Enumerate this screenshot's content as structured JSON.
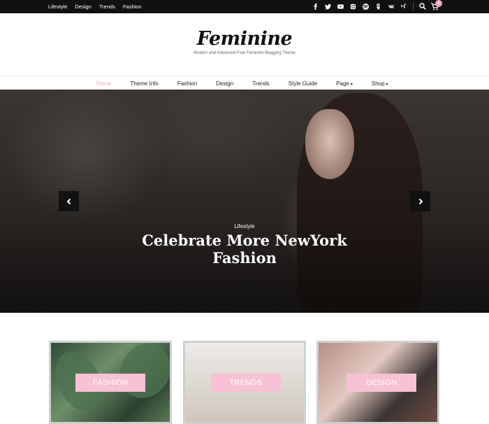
{
  "topbar": {
    "nav": [
      "Lifestyle",
      "Design",
      "Trends",
      "Fashion"
    ],
    "social_icons": [
      "facebook-icon",
      "twitter-icon",
      "youtube-icon",
      "instagram-icon",
      "spotify-icon",
      "odnoklassniki-icon",
      "vk-icon",
      "xing-icon"
    ],
    "cart_count": "0"
  },
  "brand": {
    "logo": "Feminine",
    "tagline": "Modern and Advanced Free Feminine Blogging Theme"
  },
  "mainnav": {
    "items": [
      "Home",
      "Theme Info",
      "Fashion",
      "Design",
      "Trends",
      "Style Guide",
      "Page",
      "Shop"
    ],
    "active_color": "#f0a6c4"
  },
  "hero": {
    "category": "Lifestyle",
    "title": "Celebrate More NewYork Fashion"
  },
  "cards": [
    {
      "label": "FASHION"
    },
    {
      "label": "TRENDS"
    },
    {
      "label": "DESIGN"
    }
  ],
  "colors": {
    "accent_pink": "#f7c1d6",
    "topbar_bg": "#111111"
  }
}
